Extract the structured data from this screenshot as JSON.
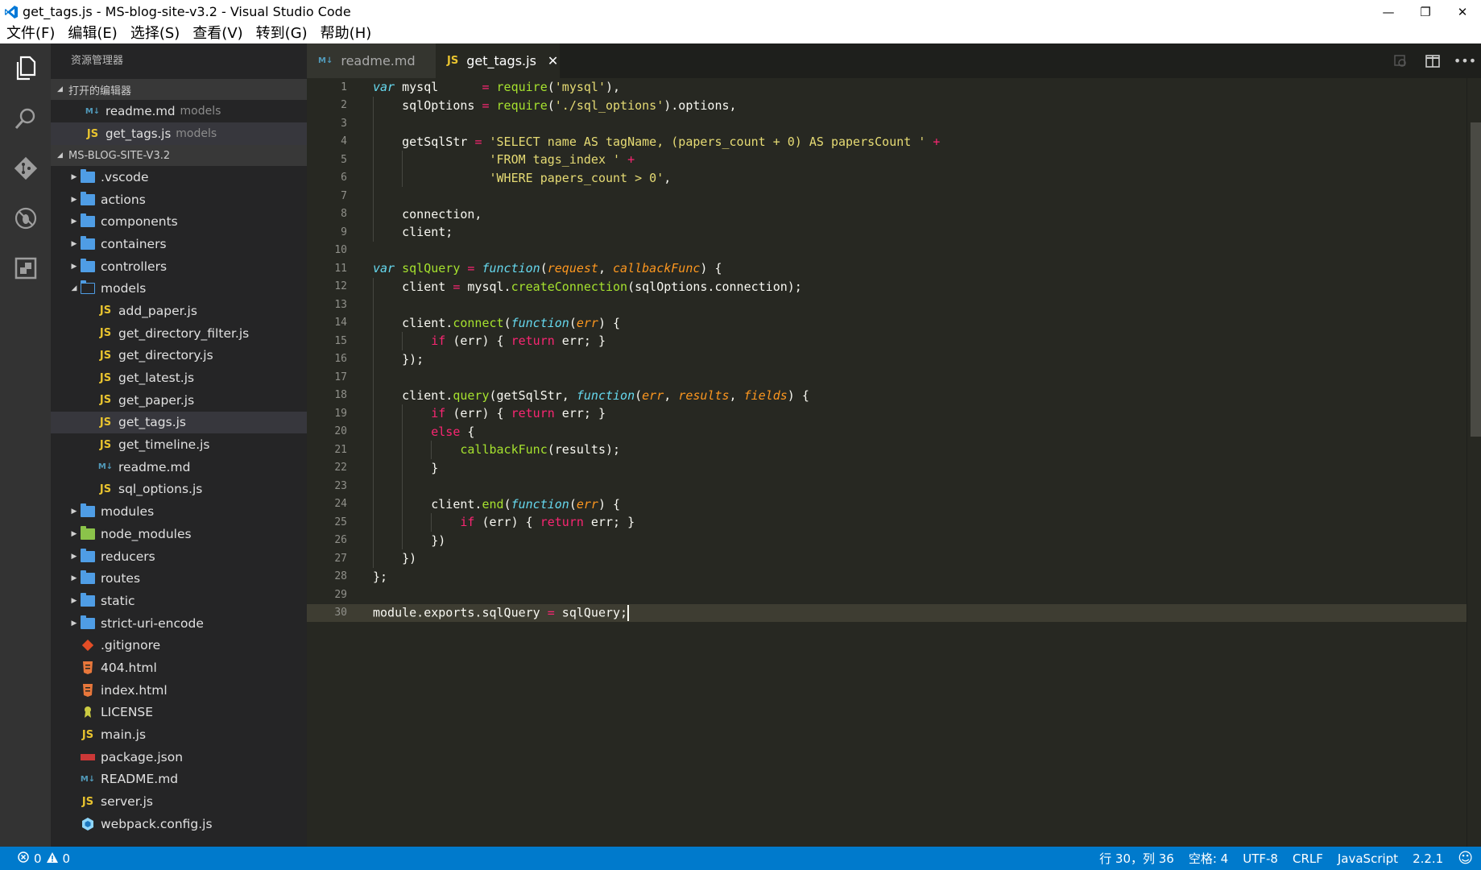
{
  "window": {
    "title": "get_tags.js - MS-blog-site-v3.2 - Visual Studio Code",
    "minimize": "—",
    "restore": "❐",
    "close": "✕"
  },
  "menu": [
    "文件(F)",
    "编辑(E)",
    "选择(S)",
    "查看(V)",
    "转到(G)",
    "帮助(H)"
  ],
  "sidebar": {
    "title": "资源管理器",
    "open_editors_header": "打开的编辑器",
    "open_editors": [
      {
        "name": "readme.md",
        "desc": "models",
        "icon": "markdown-icon"
      },
      {
        "name": "get_tags.js",
        "desc": "models",
        "icon": "js-icon"
      }
    ],
    "project_header": "MS-BLOG-SITE-V3.2",
    "tree": [
      {
        "name": ".vscode",
        "type": "folder"
      },
      {
        "name": "actions",
        "type": "folder"
      },
      {
        "name": "components",
        "type": "folder"
      },
      {
        "name": "containers",
        "type": "folder"
      },
      {
        "name": "controllers",
        "type": "folder"
      },
      {
        "name": "models",
        "type": "folder-open"
      },
      {
        "name": "add_paper.js",
        "type": "js"
      },
      {
        "name": "get_directory_filter.js",
        "type": "js"
      },
      {
        "name": "get_directory.js",
        "type": "js"
      },
      {
        "name": "get_latest.js",
        "type": "js"
      },
      {
        "name": "get_paper.js",
        "type": "js"
      },
      {
        "name": "get_tags.js",
        "type": "js"
      },
      {
        "name": "get_timeline.js",
        "type": "js"
      },
      {
        "name": "readme.md",
        "type": "md"
      },
      {
        "name": "sql_options.js",
        "type": "js"
      },
      {
        "name": "modules",
        "type": "folder"
      },
      {
        "name": "node_modules",
        "type": "folder-node"
      },
      {
        "name": "reducers",
        "type": "folder"
      },
      {
        "name": "routes",
        "type": "folder"
      },
      {
        "name": "static",
        "type": "folder"
      },
      {
        "name": "strict-uri-encode",
        "type": "folder"
      },
      {
        "name": ".gitignore",
        "type": "git"
      },
      {
        "name": "404.html",
        "type": "html"
      },
      {
        "name": "index.html",
        "type": "html"
      },
      {
        "name": "LICENSE",
        "type": "license"
      },
      {
        "name": "main.js",
        "type": "js"
      },
      {
        "name": "package.json",
        "type": "npm"
      },
      {
        "name": "README.md",
        "type": "md"
      },
      {
        "name": "server.js",
        "type": "js"
      },
      {
        "name": "webpack.config.js",
        "type": "webpack"
      }
    ]
  },
  "tabs": [
    {
      "label": "readme.md",
      "icon_text": "M↓"
    },
    {
      "label": "get_tags.js",
      "icon_text": "JS",
      "close": "✕"
    }
  ],
  "icons": {
    "js": "JS",
    "md": "M↓"
  },
  "line_numbers": [
    "1",
    "2",
    "3",
    "4",
    "5",
    "6",
    "7",
    "8",
    "9",
    "10",
    "11",
    "12",
    "13",
    "14",
    "15",
    "16",
    "17",
    "18",
    "19",
    "20",
    "21",
    "22",
    "23",
    "24",
    "25",
    "26",
    "27",
    "28",
    "29",
    "30"
  ],
  "statusbar": {
    "errors": "0",
    "warnings": "0",
    "position": "行 30，列 36",
    "spaces": "空格: 4",
    "encoding": "UTF-8",
    "eol": "CRLF",
    "language": "JavaScript",
    "version": "2.2.1",
    "feedback": "☺"
  },
  "colors": {
    "statusbar": "#007acc",
    "editor_bg": "#272822",
    "sidebar_bg": "#252526"
  }
}
